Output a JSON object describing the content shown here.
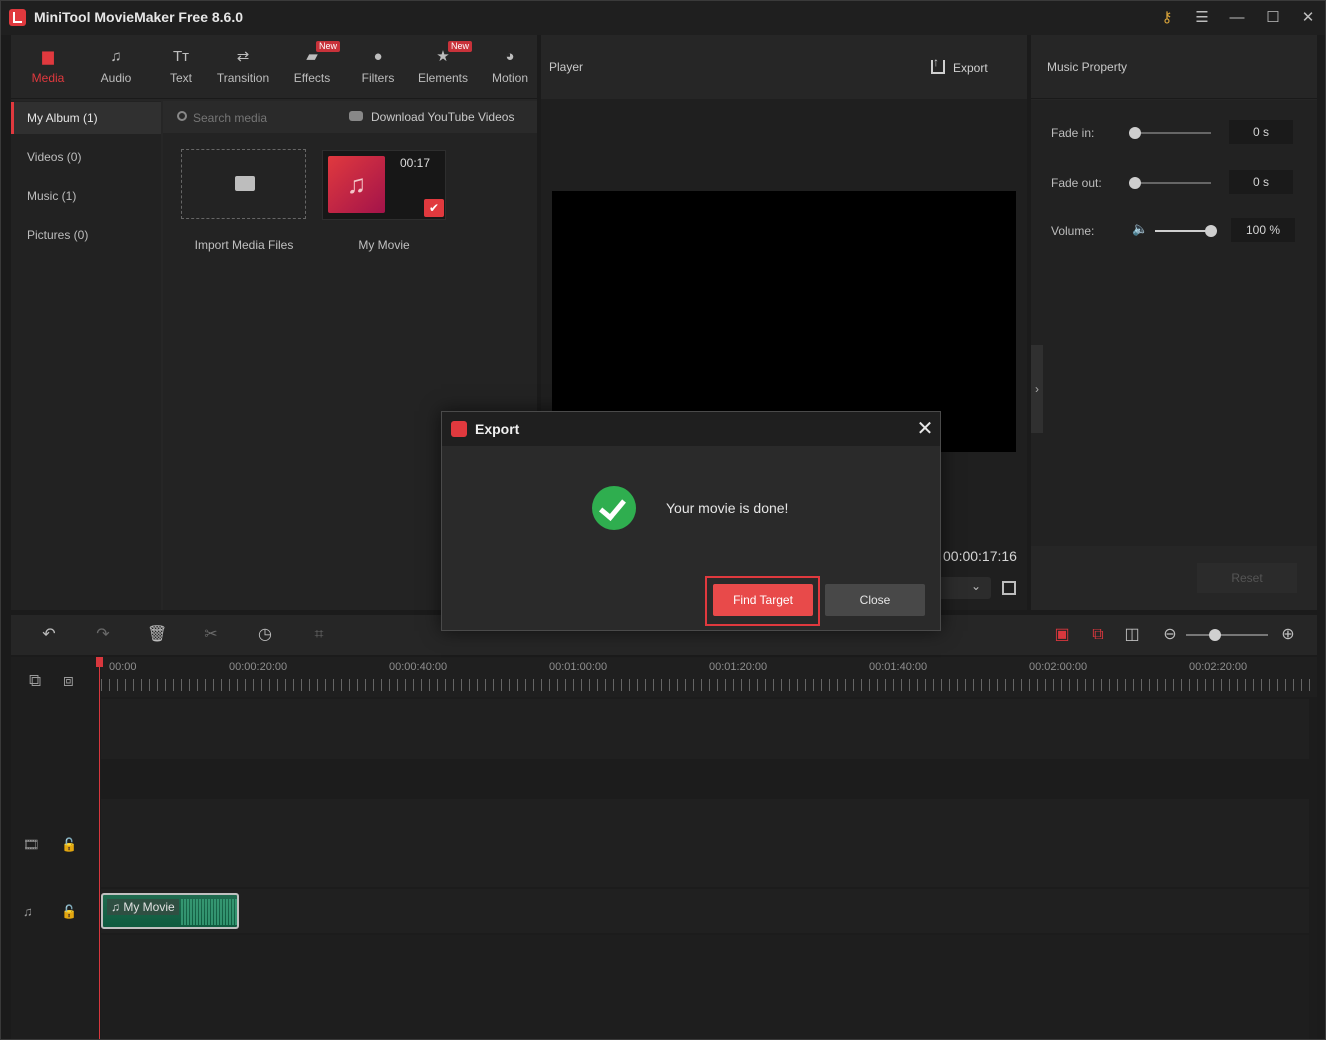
{
  "app": {
    "title": "MiniTool MovieMaker Free 8.6.0"
  },
  "tabs": [
    {
      "label": "Media",
      "icon": "folder-icon",
      "badge": ""
    },
    {
      "label": "Audio",
      "icon": "music-note-icon",
      "badge": ""
    },
    {
      "label": "Text",
      "icon": "text-icon",
      "badge": ""
    },
    {
      "label": "Transition",
      "icon": "transition-arrows-icon",
      "badge": ""
    },
    {
      "label": "Effects",
      "icon": "effects-icon",
      "badge": "New"
    },
    {
      "label": "Filters",
      "icon": "filters-icon",
      "badge": ""
    },
    {
      "label": "Elements",
      "icon": "elements-icon",
      "badge": "New"
    },
    {
      "label": "Motion",
      "icon": "motion-icon",
      "badge": ""
    }
  ],
  "albums": [
    "My Album (1)",
    "Videos (0)",
    "Music (1)",
    "Pictures (0)"
  ],
  "media": {
    "search_placeholder": "Search media",
    "youtube_link": "Download YouTube Videos",
    "import_label": "Import Media Files",
    "item_duration": "00:17",
    "item_label": "My Movie"
  },
  "player": {
    "title": "Player",
    "export_label": "Export",
    "time": "00:00:17:16"
  },
  "property": {
    "title": "Music Property",
    "fade_in_label": "Fade in:",
    "fade_in_value": "0 s",
    "fade_in_level": 0,
    "fade_out_label": "Fade out:",
    "fade_out_value": "0 s",
    "fade_out_level": 0,
    "volume_label": "Volume:",
    "volume_value": "100 %",
    "volume_level": 1.0,
    "reset_label": "Reset"
  },
  "timeline": {
    "ticks": [
      "00:00",
      "00:00:20:00",
      "00:00:40:00",
      "00:01:00:00",
      "00:01:20:00",
      "00:01:40:00",
      "00:02:00:00",
      "00:02:20:00"
    ],
    "zoom_level": 0.35,
    "clip_label": "My Movie"
  },
  "dialog": {
    "title": "Export",
    "message": "Your movie is done!",
    "find_target_label": "Find Target",
    "close_label": "Close"
  },
  "colors": {
    "accent": "#e0393e",
    "success": "#2fae4f",
    "clip": "#1f6b4f"
  }
}
